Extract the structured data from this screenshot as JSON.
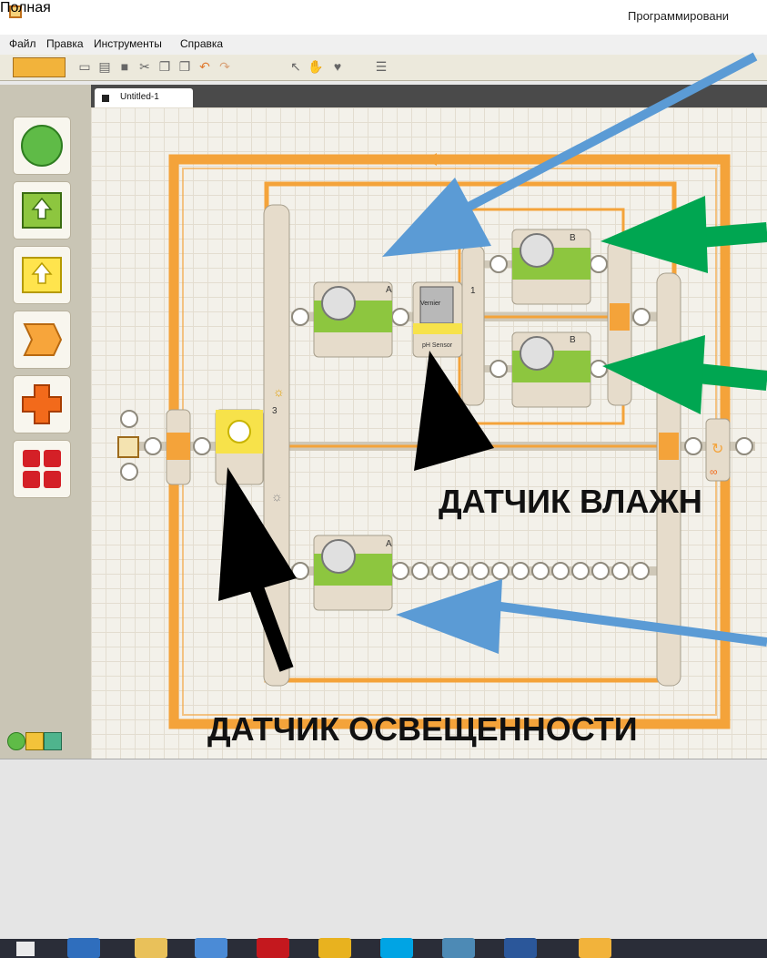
{
  "window": {
    "title": "Программировани"
  },
  "menu": [
    "Файл",
    "Правка",
    "Инструменты",
    "Справка"
  ],
  "palette": {
    "label": "Полная"
  },
  "tabs": [
    {
      "label": "Untitled-1"
    }
  ],
  "blocks": {
    "motor_a_top": {
      "port": "A"
    },
    "sensor": {
      "label": "pH Sensor",
      "port": "1",
      "brand": "Vernier"
    },
    "motor_b_top": {
      "port": "B"
    },
    "motor_b_bottom": {
      "port": "B"
    },
    "light_switch": {
      "port": "3"
    },
    "motor_a_bottom": {
      "port": "A"
    }
  },
  "annotations": {
    "humidity_sensor": "ДАТЧИК ВЛАЖН",
    "light_sensor": "ДАТЧИК ОСВЕЩЕННОСТИ"
  },
  "colors": {
    "accent_orange": "#f4a33a",
    "motor_green": "#8dc63f",
    "arrow_blue": "#5b9bd5",
    "arrow_green": "#00a651",
    "arrow_black": "#000000"
  },
  "taskbar_icons": [
    "windows-start-icon",
    "internet-explorer-icon",
    "file-explorer-icon",
    "mail-icon",
    "opera-icon",
    "chrome-icon",
    "skype-icon",
    "photos-icon",
    "word-icon",
    "nxt-icon"
  ]
}
